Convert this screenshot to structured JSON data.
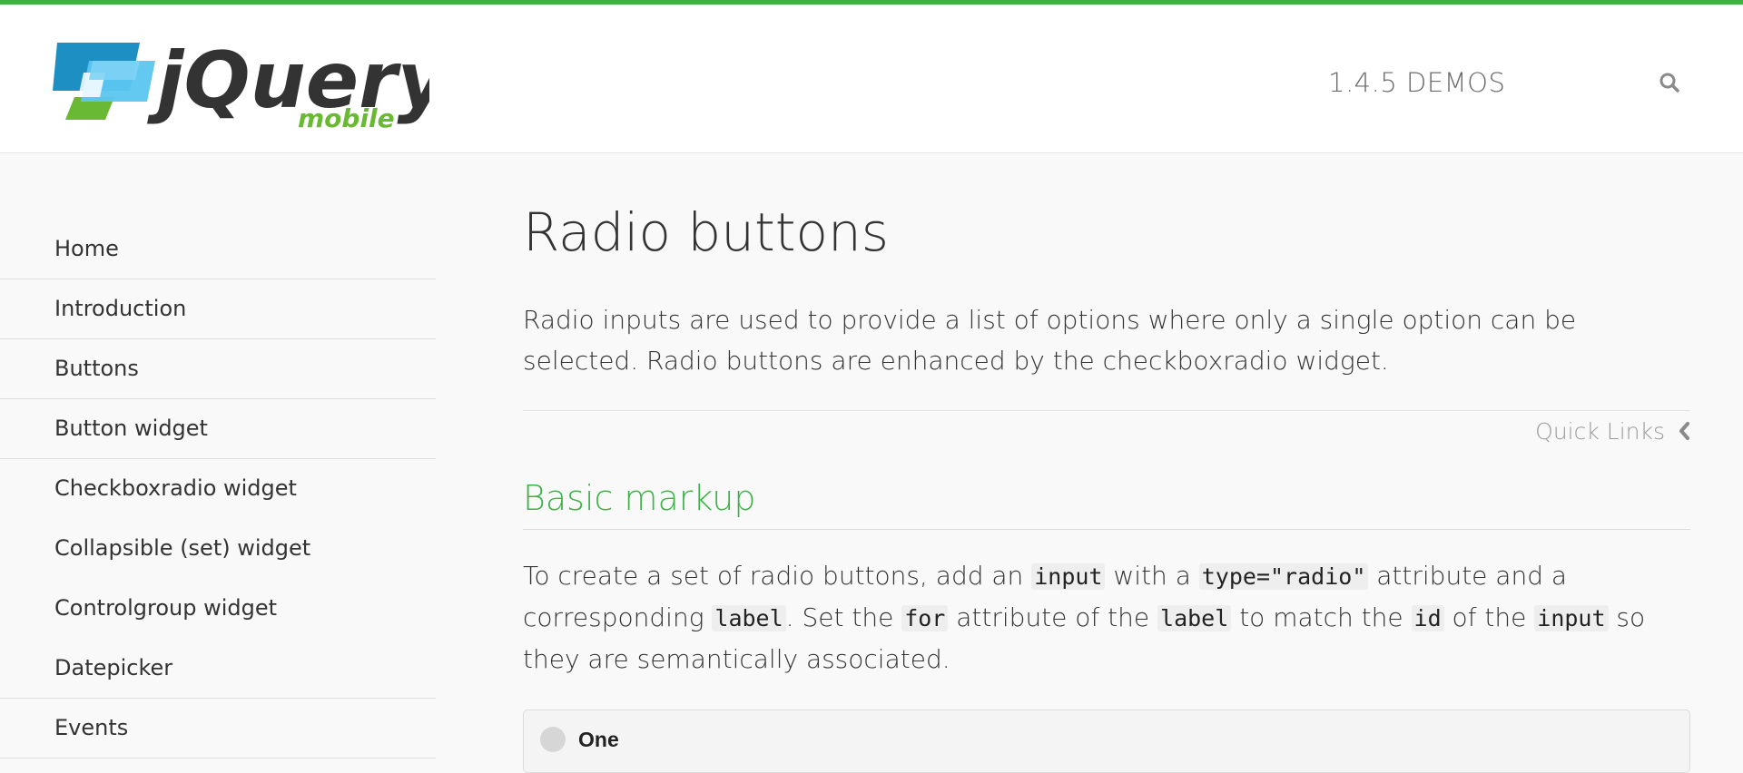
{
  "header": {
    "logo_word": "jQuery",
    "logo_sub": "mobile",
    "version_label": "1.4.5 DEMOS"
  },
  "sidebar": {
    "items": [
      {
        "label": "Home"
      },
      {
        "label": "Introduction"
      },
      {
        "label": "Buttons"
      },
      {
        "label": "Button widget"
      },
      {
        "label": "Checkboxradio widget"
      },
      {
        "label": "Collapsible (set) widget"
      },
      {
        "label": "Controlgroup widget"
      },
      {
        "label": "Datepicker"
      },
      {
        "label": "Events"
      }
    ]
  },
  "main": {
    "title": "Radio buttons",
    "intro": "Radio inputs are used to provide a list of options where only a single option can be selected. Radio buttons are enhanced by the checkboxradio widget.",
    "quick_links": "Quick Links",
    "section_title": "Basic markup",
    "markup_text": {
      "t1": "To create a set of radio buttons, add an ",
      "c1": "input",
      "t2": " with a ",
      "c2": "type=\"radio\"",
      "t3": " attribute and a corresponding ",
      "c3": "label",
      "t4": ". Set the ",
      "c4": "for",
      "t5": " attribute of the ",
      "c5": "label",
      "t6": " to match the ",
      "c6": "id",
      "t7": " of the ",
      "c7": "input",
      "t8": " so they are semantically associated."
    },
    "radio_option": "One"
  },
  "colors": {
    "brand_green": "#3eb249",
    "logo_blue": "#1e8fc2",
    "logo_light_blue": "#5bc6f0",
    "text": "#333333"
  },
  "icons": {
    "search": "search-icon",
    "quick_links": "chevron-left-icon"
  }
}
